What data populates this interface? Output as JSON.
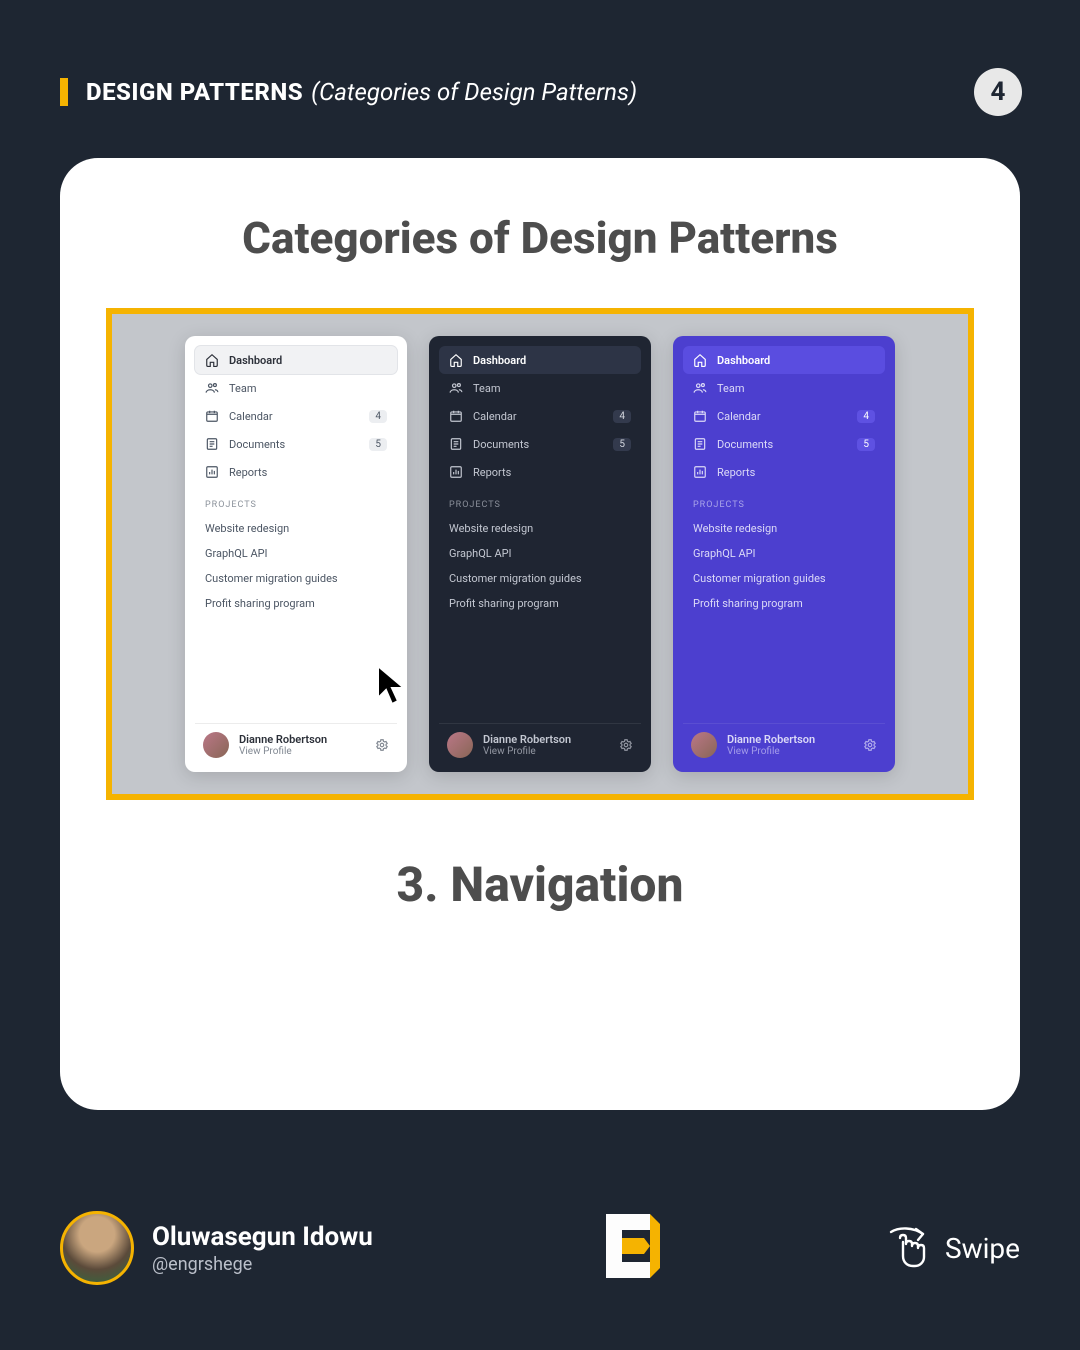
{
  "header": {
    "title_bold": "DESIGN PATTERNS",
    "title_italic": "(Categories of Design Patterns)",
    "page_number": "4"
  },
  "card": {
    "heading": "Categories of Design Patterns",
    "subheading": "3. Navigation"
  },
  "sidebar": {
    "nav": [
      {
        "icon": "home-icon",
        "label": "Dashboard",
        "badge": "",
        "active": true
      },
      {
        "icon": "team-icon",
        "label": "Team",
        "badge": "",
        "active": false
      },
      {
        "icon": "calendar-icon",
        "label": "Calendar",
        "badge": "4",
        "active": false
      },
      {
        "icon": "document-icon",
        "label": "Documents",
        "badge": "5",
        "active": false
      },
      {
        "icon": "chart-icon",
        "label": "Reports",
        "badge": "",
        "active": false
      }
    ],
    "section_label": "PROJECTS",
    "projects": [
      "Website redesign",
      "GraphQL API",
      "Customer migration guides",
      "Profit sharing program"
    ],
    "profile": {
      "name": "Dianne Robertson",
      "view": "View Profile"
    }
  },
  "footer": {
    "author_name": "Oluwasegun Idowu",
    "author_handle": "@engrshege",
    "swipe_label": "Swipe"
  },
  "colors": {
    "accent": "#f5b301",
    "card_bg": "#ffffff",
    "page_bg": "#1e2632",
    "sidebar_dark": "#1f2532",
    "sidebar_purple": "#4c3fcf"
  }
}
